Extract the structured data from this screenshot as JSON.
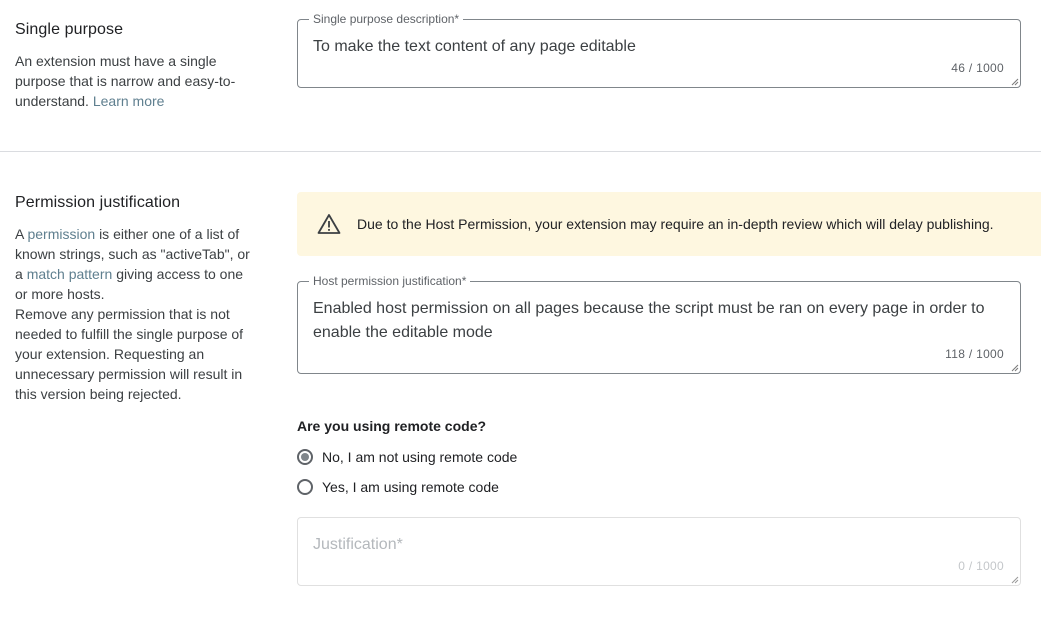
{
  "single_purpose": {
    "title": "Single purpose",
    "desc_prefix": "An extension must have a single purpose that is narrow and easy-to-understand.",
    "learn_more": "Learn more",
    "field_label": "Single purpose description*",
    "field_value": "To make the text content of any page editable",
    "counter": "46 / 1000"
  },
  "permission": {
    "title": "Permission justification",
    "desc_1": "A",
    "desc_permission_link": "permission",
    "desc_2": "is either one of a list of known strings, such as \"activeTab\", or a",
    "desc_match_link": "match pattern",
    "desc_3": "giving access to one or more hosts.",
    "desc_4": "Remove any permission that is not needed to fulfill the single purpose of your extension. Requesting an unnecessary permission will result in this version being rejected.",
    "banner_text": "Due to the Host Permission, your extension may require an in-depth review which will delay publishing.",
    "banner_icon": "warning-icon",
    "host_field_label": "Host permission justification*",
    "host_field_value": "Enabled host permission on all pages because the script must be ran on every page in order to enable the editable mode",
    "host_counter": "118 / 1000"
  },
  "remote_code": {
    "question": "Are you using remote code?",
    "options": [
      {
        "label": "No, I am not using remote code",
        "selected": true
      },
      {
        "label": "Yes, I am using remote code",
        "selected": false
      }
    ],
    "justification_placeholder": "Justification*",
    "justification_counter": "0 / 1000"
  },
  "colors": {
    "banner_bg": "#fef7e0",
    "link": "#5f7f8f",
    "border": "#80868b"
  }
}
